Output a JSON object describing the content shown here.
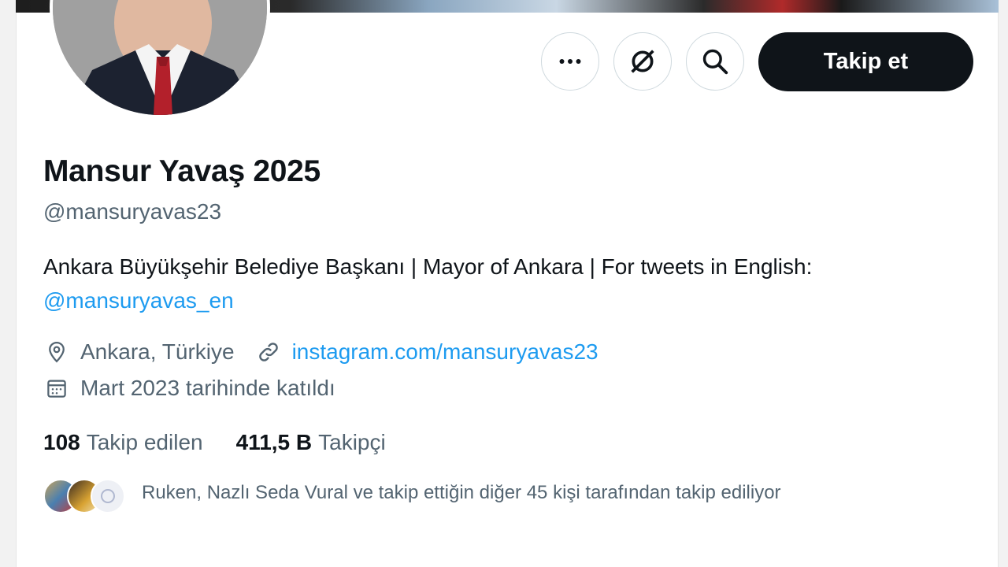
{
  "profile": {
    "display_name": "Mansur Yavaş 2025",
    "handle": "@mansuryavas23",
    "bio_text": "Ankara Büyükşehir Belediye Başkanı | Mayor of Ankara | For tweets in English:",
    "bio_mention": "@mansuryavas_en",
    "location": "Ankara, Türkiye",
    "website": "instagram.com/mansuryavas23",
    "joined": "Mart 2023 tarihinde katıldı"
  },
  "actions": {
    "more_icon": "more-icon",
    "grok_icon": "grok-icon",
    "search_icon": "search-icon",
    "follow_label": "Takip et"
  },
  "stats": {
    "following_count": "108",
    "following_label": "Takip edilen",
    "followers_count": "411,5 B",
    "followers_label": "Takipçi"
  },
  "followed_by": {
    "text": "Ruken, Nazlı Seda Vural ve takip ettiğin diğer 45 kişi tarafından takip ediliyor"
  },
  "colors": {
    "accent": "#1d9bf0",
    "text_primary": "#0f1419",
    "text_secondary": "#536471",
    "button_dark": "#0f1419"
  }
}
